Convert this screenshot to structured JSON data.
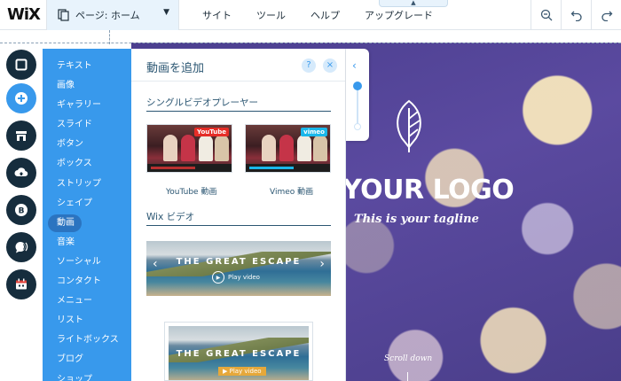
{
  "topbar": {
    "logo": "WiX",
    "page_select": "ページ: ホーム",
    "menu": [
      "サイト",
      "ツール",
      "ヘルプ",
      "アップグレード"
    ],
    "tools": [
      "zoom-out-icon",
      "undo-icon",
      "redo-icon"
    ]
  },
  "rail": {
    "items": [
      "background-icon",
      "add-icon",
      "store-icon",
      "upload-icon",
      "blog-icon",
      "chat-icon",
      "calendar-icon"
    ],
    "active_index": 1
  },
  "categories": {
    "items": [
      "テキスト",
      "画像",
      "ギャラリー",
      "スライド",
      "ボタン",
      "ボックス",
      "ストリップ",
      "シェイプ",
      "動画",
      "音楽",
      "ソーシャル",
      "コンタクト",
      "メニュー",
      "リスト",
      "ライトボックス",
      "ブログ",
      "ショップ"
    ],
    "active": "動画"
  },
  "panel": {
    "title": "動画を追加",
    "help": "?",
    "close": "×",
    "section1": "シングルビデオプレーヤー",
    "youtube_label": "YouTube 動画",
    "vimeo_label": "Vimeo 動画",
    "youtube_badge": "YouTube",
    "vimeo_badge": "vimeo",
    "section2": "Wix ビデオ",
    "escape_title": "THE GREAT ESCAPE",
    "escape_play": "Play video"
  },
  "canvas": {
    "logo_text": "YOUR LOGO",
    "tagline": "This is your tagline",
    "scroll": "Scroll down"
  },
  "colors": {
    "accent": "#3899ec",
    "rail_dark": "#162d3d",
    "hero": "#4b3f8f"
  }
}
